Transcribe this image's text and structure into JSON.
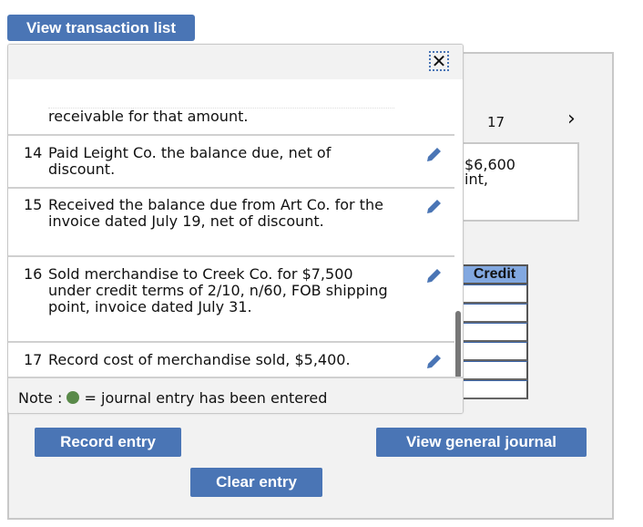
{
  "header": {
    "tab_label": "View transaction list"
  },
  "background": {
    "transaction_number": "17",
    "next_icon": "chevron-right",
    "description_lines": [
      "$6,600",
      "int,"
    ],
    "credit_header": "Credit",
    "credit_cells": [
      "",
      "",
      "",
      "",
      "",
      ""
    ]
  },
  "popup": {
    "close_label": "✕",
    "partial_item_text": "receivable for that amount.",
    "items": [
      {
        "num": "14",
        "text": "Paid Leight Co. the balance due, net of discount.",
        "icon": "pencil-icon"
      },
      {
        "num": "15",
        "text": "Received the balance due from Art Co. for the invoice dated July 19, net of discount.",
        "icon": "pencil-icon"
      },
      {
        "num": "16",
        "text": "Sold merchandise to Creek Co. for $7,500 under credit terms of 2/10, n/60, FOB shipping point, invoice dated July 31.",
        "icon": "pencil-icon"
      },
      {
        "num": "17",
        "text": "Record cost of merchandise sold, $5,400.",
        "icon": "pencil-icon"
      }
    ],
    "note_prefix": "Note :",
    "note_suffix": "= journal entry has been entered",
    "entered_color": "#5a8a4a"
  },
  "buttons": {
    "record": "Record entry",
    "clear": "Clear entry",
    "view_journal": "View general journal"
  },
  "colors": {
    "accent": "#4a75b5",
    "credit_header": "#82a8e0"
  }
}
